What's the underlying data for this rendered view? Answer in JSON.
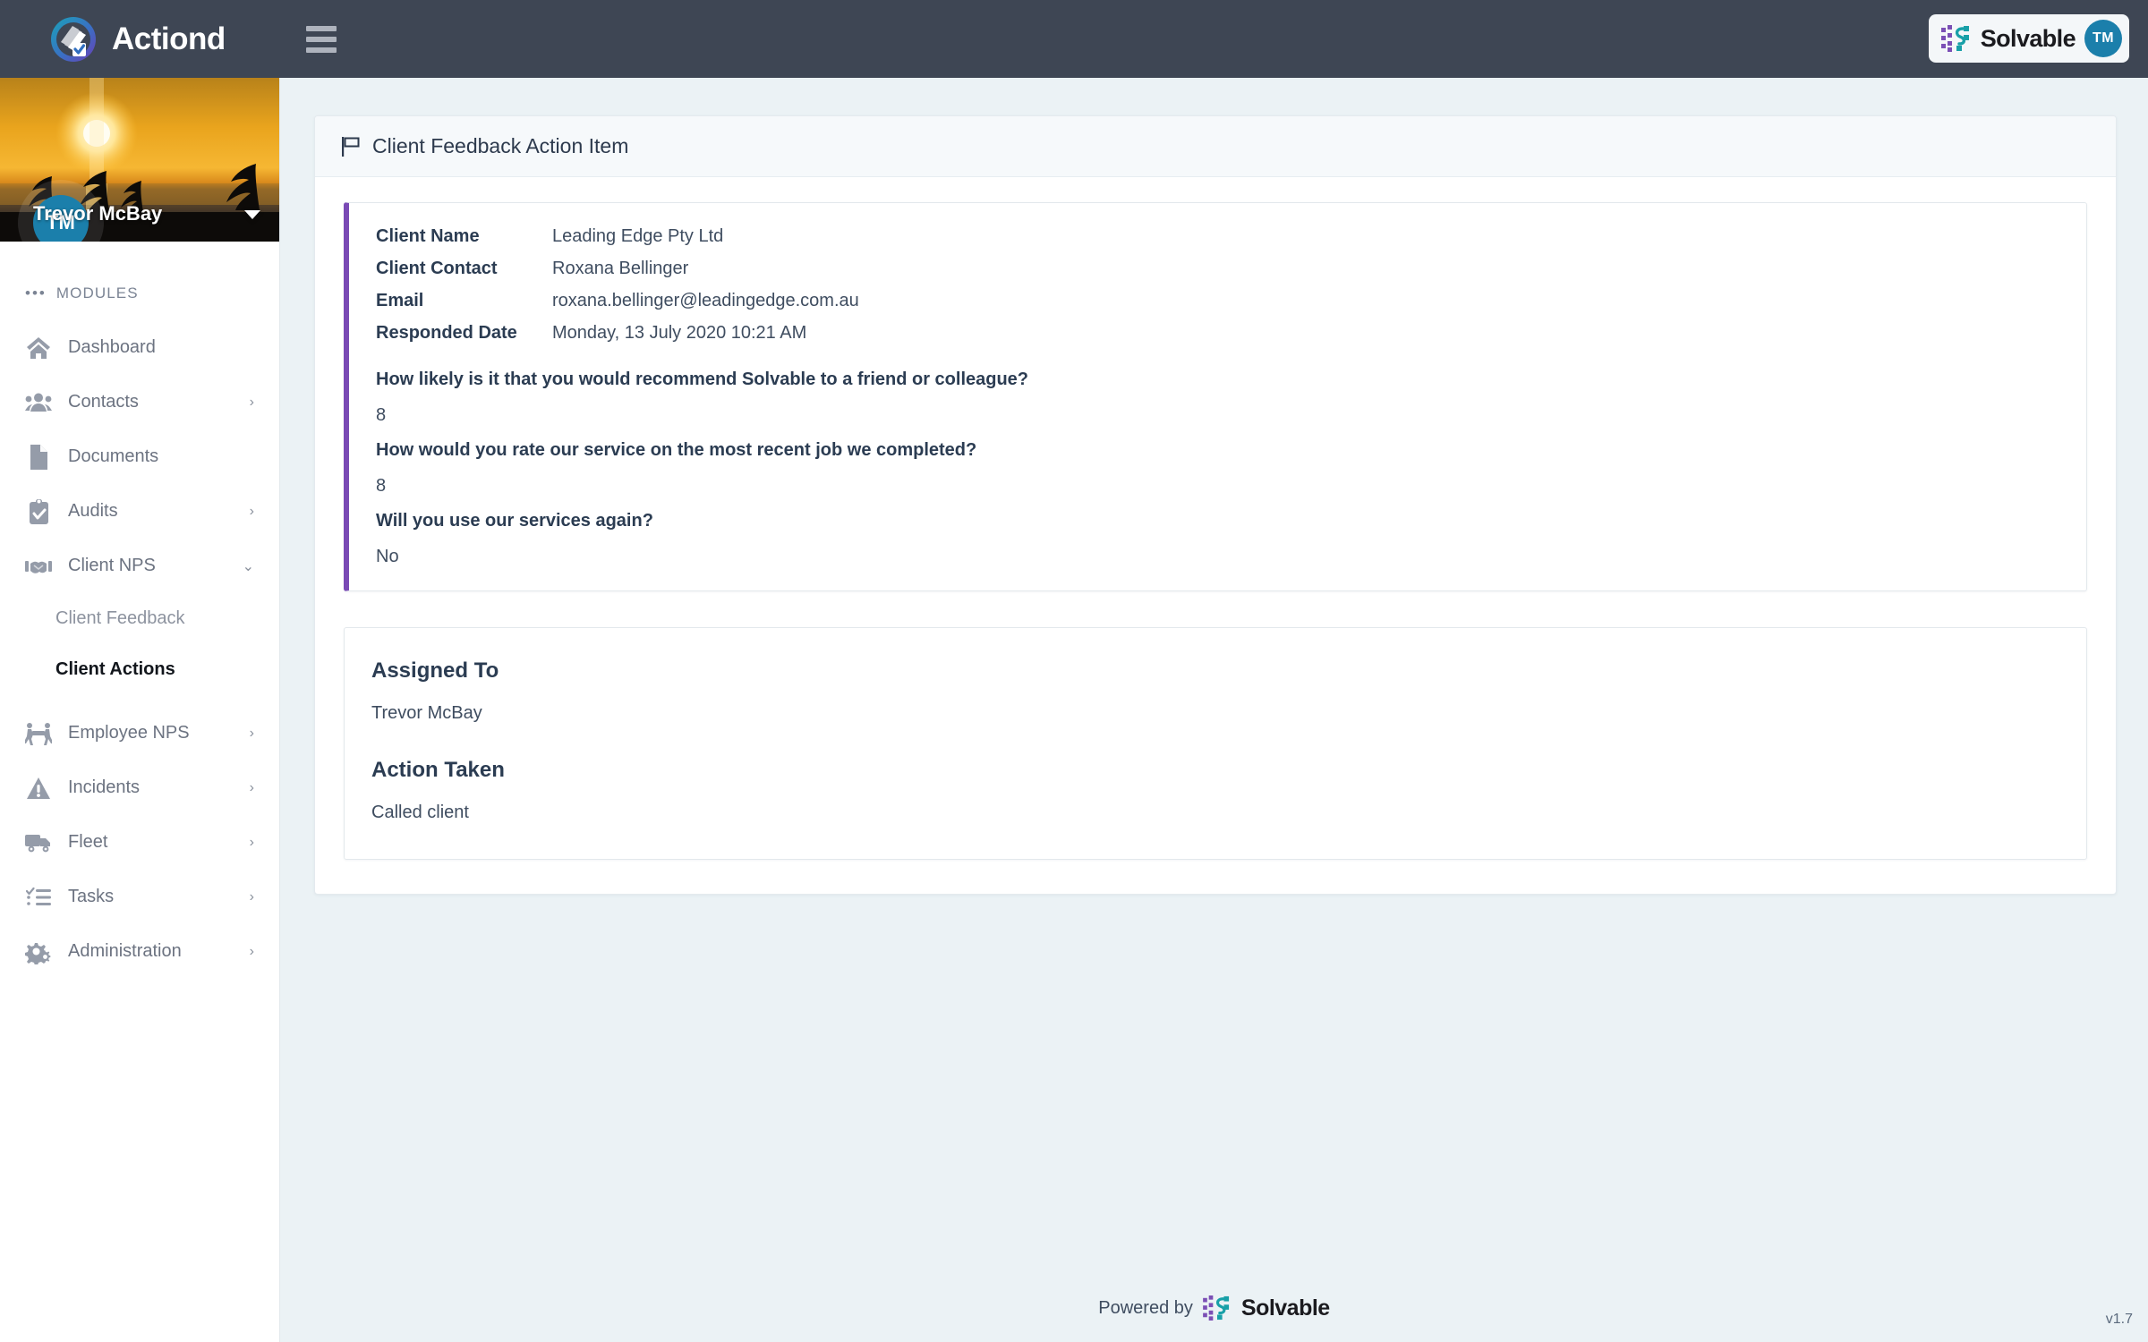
{
  "app": {
    "name": "Actiond",
    "version_label": "v1.7"
  },
  "topbar": {
    "logo_icon": "actiond-logo-icon",
    "menu_icon": "hamburger-menu-icon",
    "product_badge": {
      "mark_icon": "solvable-mark-icon",
      "name": "Solvable",
      "trademark": "TM"
    }
  },
  "sidebar": {
    "profile": {
      "initials": "TM",
      "name": "Trevor McBay",
      "caret_icon": "chevron-down-icon"
    },
    "section_label": "MODULES",
    "items": [
      {
        "label": "Dashboard",
        "icon": "home-icon",
        "chevron": ""
      },
      {
        "label": "Contacts",
        "icon": "people-icon",
        "chevron": "›"
      },
      {
        "label": "Documents",
        "icon": "document-icon",
        "chevron": ""
      },
      {
        "label": "Audits",
        "icon": "clipboard-check-icon",
        "chevron": "›"
      },
      {
        "label": "Client NPS",
        "icon": "handshake-icon",
        "chevron": "⌄"
      }
    ],
    "sub_items": [
      {
        "label": "Client Feedback",
        "active": false
      },
      {
        "label": "Client Actions",
        "active": true
      }
    ],
    "items_after": [
      {
        "label": "Employee NPS",
        "icon": "people-carry-icon",
        "chevron": "›"
      },
      {
        "label": "Incidents",
        "icon": "warning-triangle-icon",
        "chevron": "›"
      },
      {
        "label": "Fleet",
        "icon": "truck-icon",
        "chevron": "›"
      },
      {
        "label": "Tasks",
        "icon": "task-list-icon",
        "chevron": "›"
      },
      {
        "label": "Administration",
        "icon": "gears-icon",
        "chevron": "›"
      }
    ]
  },
  "main": {
    "page_title": "Client Feedback Action Item",
    "page_title_icon": "flag-icon",
    "feedback": {
      "accent_color": "#7a4ab5",
      "fields": [
        {
          "key": "Client Name",
          "value": "Leading Edge Pty Ltd"
        },
        {
          "key": "Client Contact",
          "value": "Roxana Bellinger"
        },
        {
          "key": "Email",
          "value": "roxana.bellinger@leadingedge.com.au"
        },
        {
          "key": "Responded Date",
          "value": "Monday, 13 July 2020 10:21 AM"
        }
      ],
      "questions": [
        {
          "question": "How likely is it that you would recommend Solvable to a friend or colleague?",
          "answer": "8"
        },
        {
          "question": "How would you rate our service on the most recent job we completed?",
          "answer": "8"
        },
        {
          "question": "Will you use our services again?",
          "answer": "No"
        }
      ]
    },
    "assignment": {
      "assigned_to_label": "Assigned To",
      "assigned_to_value": "Trevor McBay",
      "action_taken_label": "Action Taken",
      "action_taken_value": "Called client"
    }
  },
  "footer": {
    "powered_text": "Powered by",
    "brand": "Solvable",
    "mark_icon": "solvable-mark-icon"
  }
}
